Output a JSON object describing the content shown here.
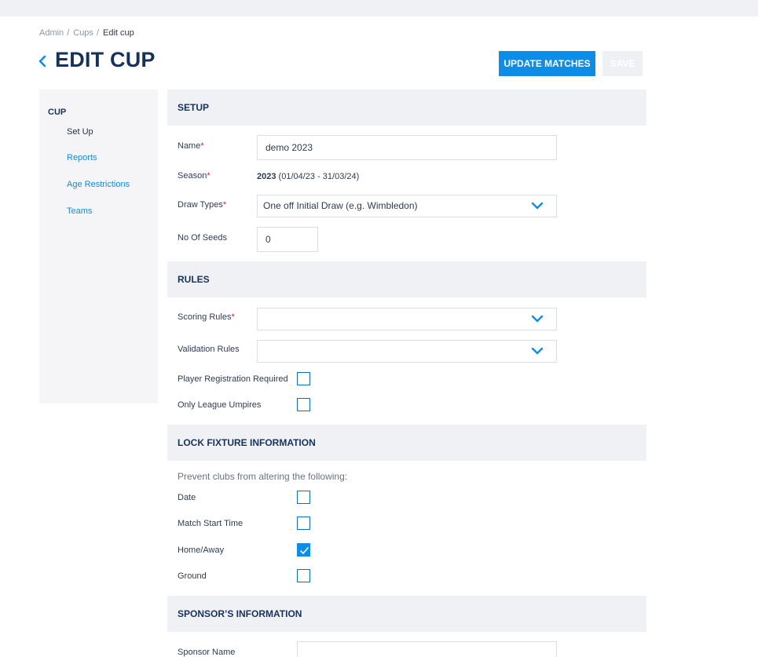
{
  "breadcrumb": {
    "items": [
      "Admin",
      "Cups"
    ],
    "separator": "/",
    "current": "Edit cup"
  },
  "header": {
    "title": "EDIT CUP",
    "update_matches_label": "UPDATE MATCHES",
    "save_label": "SAVE"
  },
  "sidebar": {
    "heading": "CUP",
    "items": [
      "Set Up",
      "Reports",
      "Age Restrictions",
      "Teams"
    ]
  },
  "setup": {
    "heading": "SETUP",
    "name_label": "Name",
    "name_value": "demo 2023",
    "season_label": "Season",
    "season_year": "2023",
    "season_range": " (01/04/23 - 31/03/24)",
    "draw_types_label": "Draw Types",
    "draw_types_value": "One off Initial Draw (e.g. Wimbledon)",
    "seeds_label": "No Of Seeds",
    "seeds_value": "0",
    "required_mark": "*"
  },
  "rules": {
    "heading": "RULES",
    "scoring_label": "Scoring Rules",
    "scoring_value": "",
    "validation_label": "Validation Rules",
    "validation_value": "",
    "player_reg_label": "Player Registration Required",
    "player_reg_checked": false,
    "umpires_label": "Only League Umpires",
    "umpires_checked": false
  },
  "lock": {
    "heading": "LOCK FIXTURE INFORMATION",
    "note": "Prevent clubs from altering the following:",
    "items": [
      {
        "label": "Date",
        "checked": false
      },
      {
        "label": "Match Start Time",
        "checked": false
      },
      {
        "label": "Home/Away",
        "checked": true
      },
      {
        "label": "Ground",
        "checked": false
      }
    ]
  },
  "sponsor": {
    "heading": "SPONSOR’S INFORMATION",
    "name_label": "Sponsor Name",
    "name_value": ""
  },
  "colors": {
    "accent": "#0e8de6",
    "title": "#17325a",
    "required": "#d0213b",
    "link": "#1789d6"
  }
}
